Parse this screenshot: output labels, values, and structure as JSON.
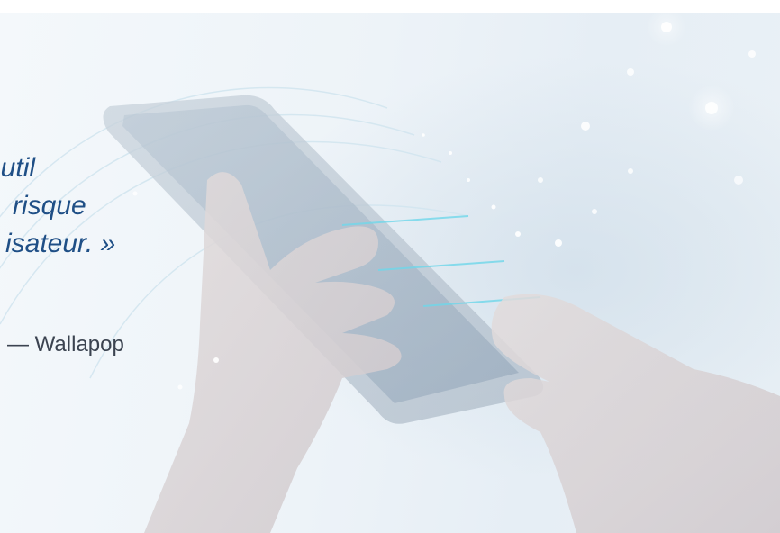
{
  "quote": {
    "lines": [
      "outil",
      "risque",
      "isateur. »"
    ],
    "author": "— Wallapop"
  }
}
